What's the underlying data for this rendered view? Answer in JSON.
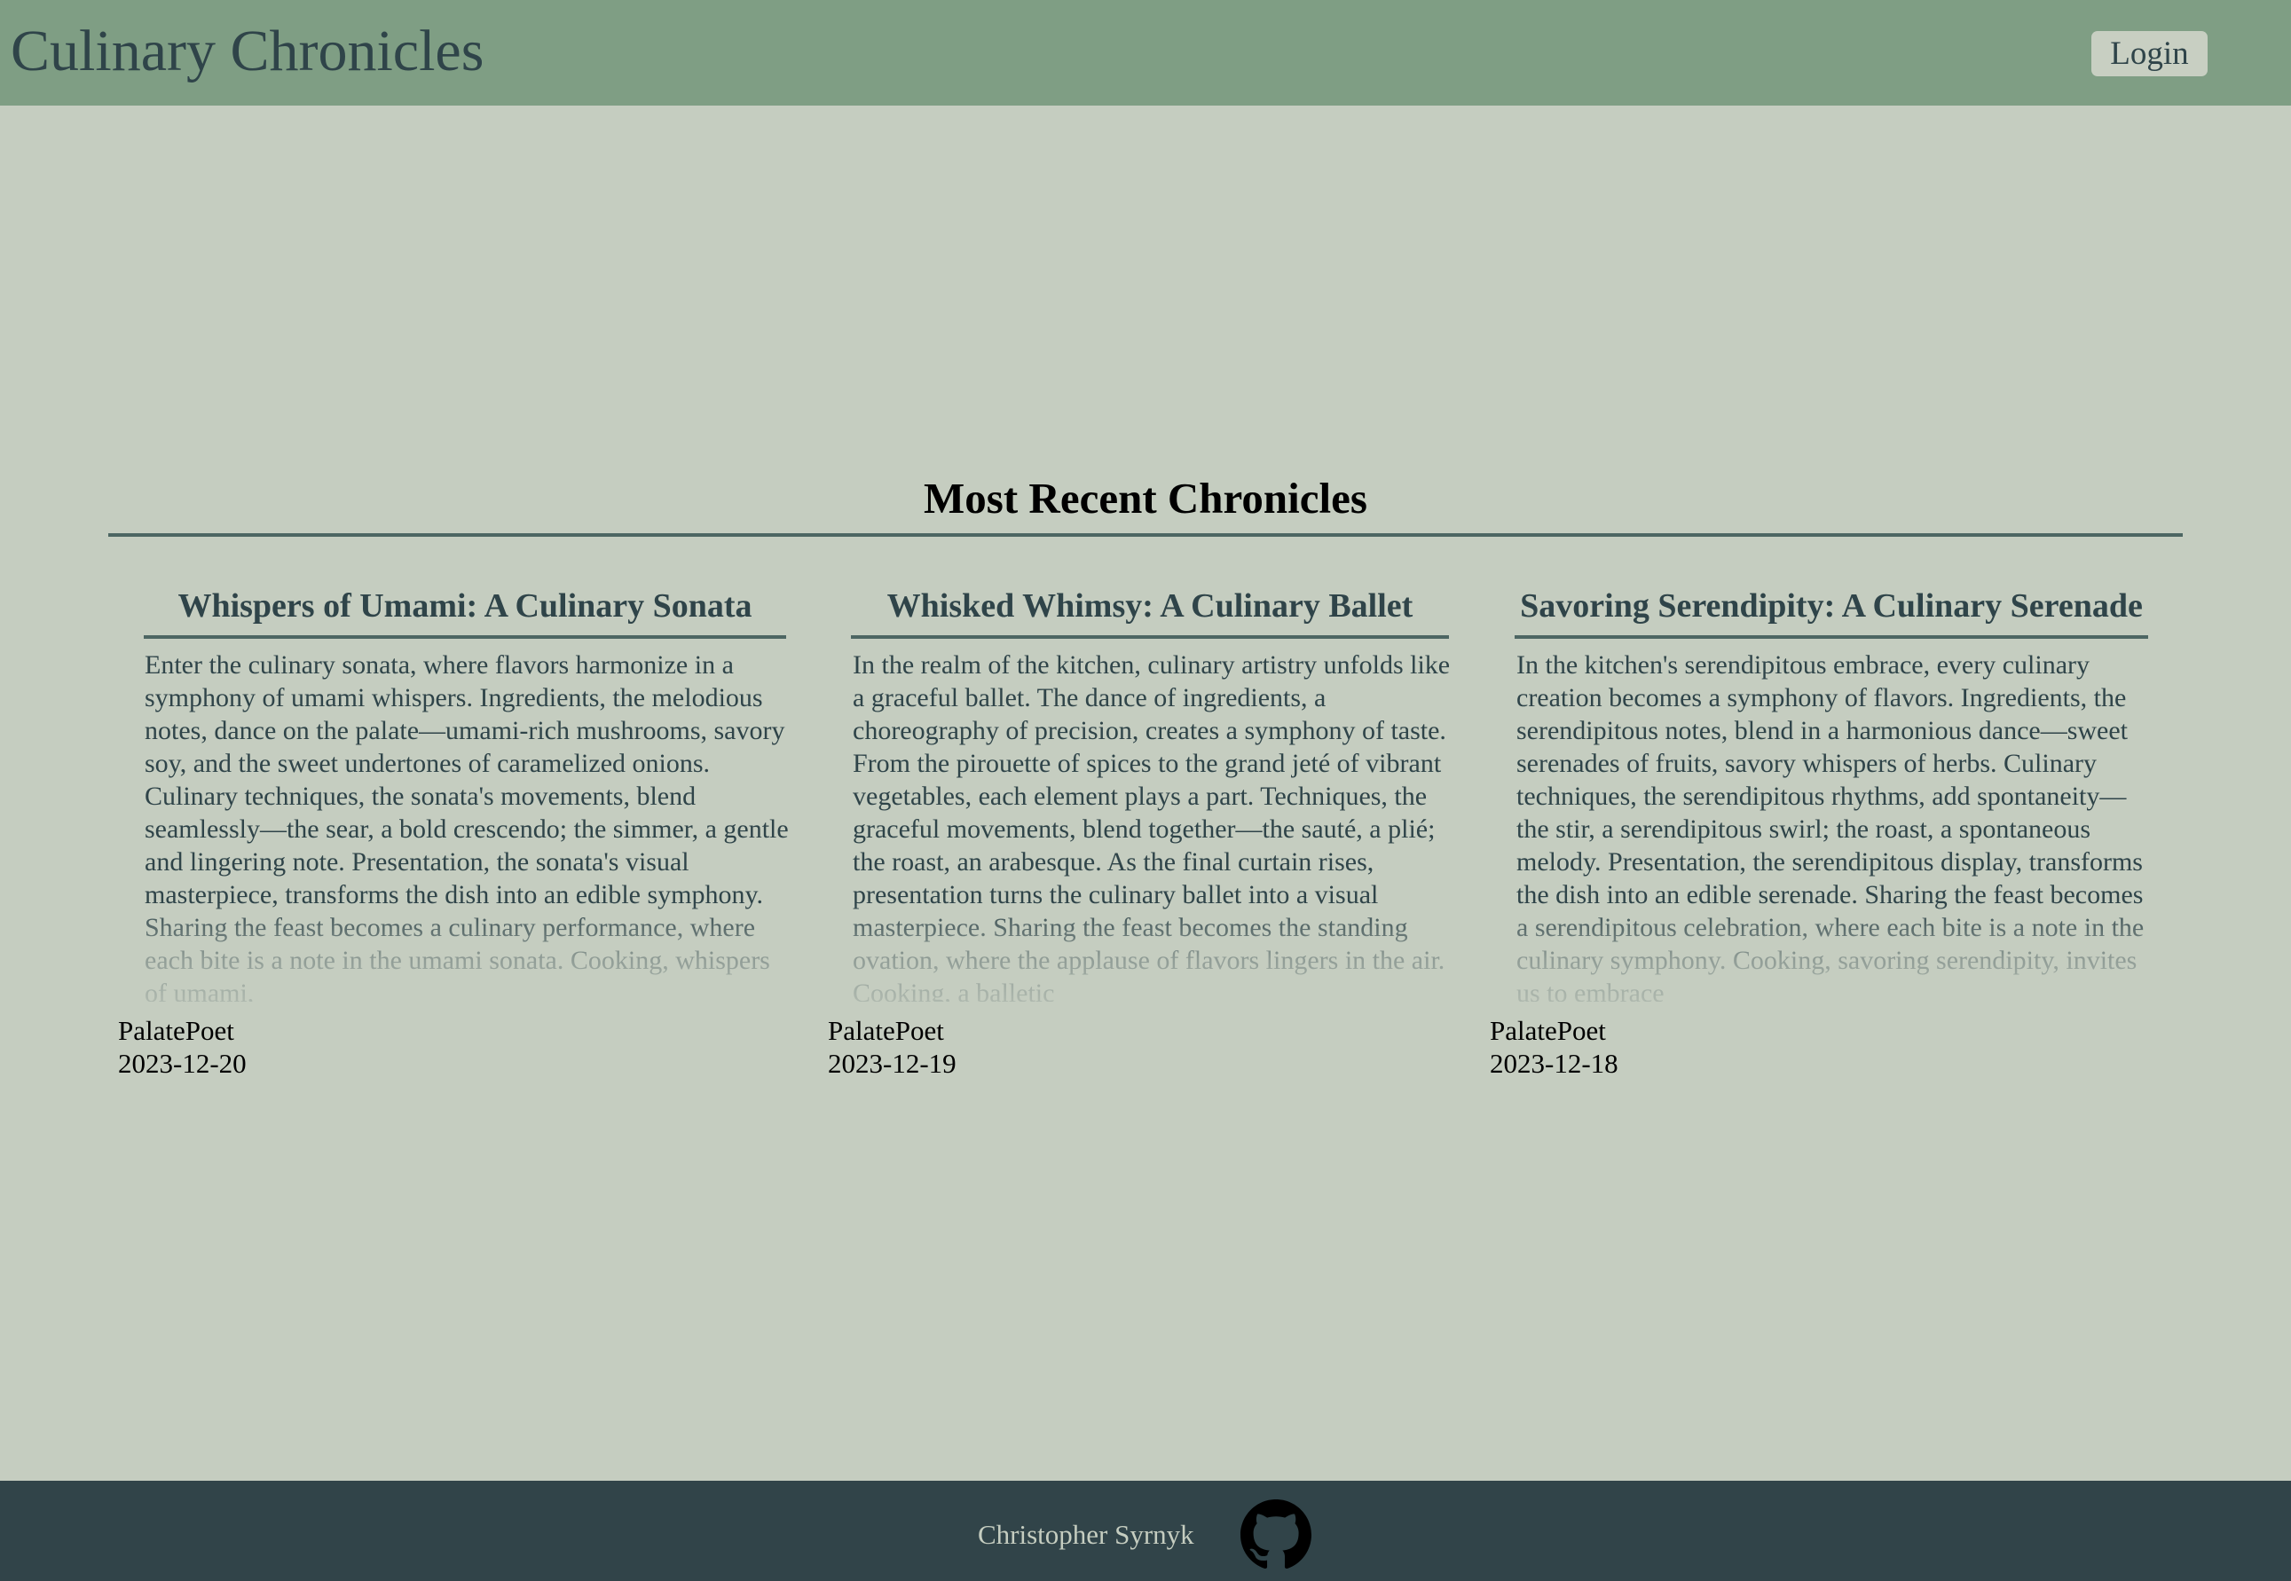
{
  "header": {
    "site_title": "Culinary Chronicles",
    "login_label": "Login"
  },
  "main": {
    "section_title": "Most Recent Chronicles",
    "posts": [
      {
        "title": "Whispers of Umami: A Culinary Sonata",
        "excerpt": "Enter the culinary sonata, where flavors harmonize in a symphony of umami whispers. Ingredients, the melodious notes, dance on the palate—umami-rich mushrooms, savory soy, and the sweet undertones of caramelized onions. Culinary techniques, the sonata's movements, blend seamlessly—the sear, a bold crescendo; the simmer, a gentle and lingering note. Presentation, the sonata's visual masterpiece, transforms the dish into an edible symphony. Sharing the feast becomes a culinary performance, where each bite is a note in the umami sonata. Cooking, whispers of umami,",
        "author": "PalatePoet",
        "date": "2023-12-20"
      },
      {
        "title": "Whisked Whimsy: A Culinary Ballet",
        "excerpt": "In the realm of the kitchen, culinary artistry unfolds like a graceful ballet. The dance of ingredients, a choreography of precision, creates a symphony of taste. From the pirouette of spices to the grand jeté of vibrant vegetables, each element plays a part. Techniques, the graceful movements, blend together—the sauté, a plié; the roast, an arabesque. As the final curtain rises, presentation turns the culinary ballet into a visual masterpiece. Sharing the feast becomes the standing ovation, where the applause of flavors lingers in the air. Cooking, a balletic",
        "author": "PalatePoet",
        "date": "2023-12-19"
      },
      {
        "title": "Savoring Serendipity: A Culinary Serenade",
        "excerpt": "In the kitchen's serendipitous embrace, every culinary creation becomes a symphony of flavors. Ingredients, the serendipitous notes, blend in a harmonious dance—sweet serenades of fruits, savory whispers of herbs. Culinary techniques, the serendipitous rhythms, add spontaneity—the stir, a serendipitous swirl; the roast, a spontaneous melody. Presentation, the serendipitous display, transforms the dish into an edible serenade. Sharing the feast becomes a serendipitous celebration, where each bite is a note in the culinary symphony. Cooking, savoring serendipity, invites us to embrace",
        "author": "PalatePoet",
        "date": "2023-12-18"
      }
    ]
  },
  "footer": {
    "author_name": "Christopher Syrnyk",
    "github_icon": "github-icon"
  },
  "colors": {
    "header_bg": "#7f9e84",
    "page_bg": "#c5cdc0",
    "footer_bg": "#314449",
    "text_dark": "#2f4449",
    "rule": "#4d6663"
  }
}
